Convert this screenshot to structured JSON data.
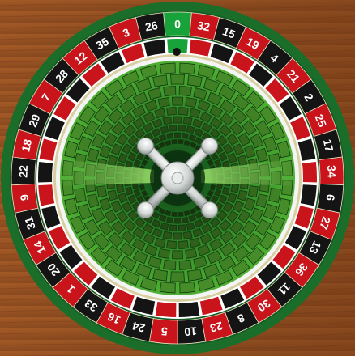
{
  "wheel": {
    "numbers": [
      {
        "n": "0",
        "c": "green"
      },
      {
        "n": "32",
        "c": "red"
      },
      {
        "n": "15",
        "c": "black"
      },
      {
        "n": "19",
        "c": "red"
      },
      {
        "n": "4",
        "c": "black"
      },
      {
        "n": "21",
        "c": "red"
      },
      {
        "n": "2",
        "c": "black"
      },
      {
        "n": "25",
        "c": "red"
      },
      {
        "n": "17",
        "c": "black"
      },
      {
        "n": "34",
        "c": "red"
      },
      {
        "n": "6",
        "c": "black"
      },
      {
        "n": "27",
        "c": "red"
      },
      {
        "n": "13",
        "c": "black"
      },
      {
        "n": "36",
        "c": "red"
      },
      {
        "n": "11",
        "c": "black"
      },
      {
        "n": "30",
        "c": "red"
      },
      {
        "n": "8",
        "c": "black"
      },
      {
        "n": "23",
        "c": "red"
      },
      {
        "n": "10",
        "c": "black"
      },
      {
        "n": "5",
        "c": "red"
      },
      {
        "n": "24",
        "c": "black"
      },
      {
        "n": "16",
        "c": "red"
      },
      {
        "n": "33",
        "c": "black"
      },
      {
        "n": "1",
        "c": "red"
      },
      {
        "n": "20",
        "c": "black"
      },
      {
        "n": "14",
        "c": "red"
      },
      {
        "n": "31",
        "c": "black"
      },
      {
        "n": "9",
        "c": "red"
      },
      {
        "n": "22",
        "c": "black"
      },
      {
        "n": "18",
        "c": "red"
      },
      {
        "n": "29",
        "c": "black"
      },
      {
        "n": "7",
        "c": "red"
      },
      {
        "n": "28",
        "c": "black"
      },
      {
        "n": "12",
        "c": "red"
      },
      {
        "n": "35",
        "c": "black"
      },
      {
        "n": "3",
        "c": "red"
      },
      {
        "n": "26",
        "c": "black"
      }
    ]
  },
  "colors": {
    "red": "#c8141a",
    "black": "#141414",
    "green": "#17a33a",
    "rim": "#1b6e2a",
    "wood": "#8a4a1f"
  },
  "icons": {
    "turret": "cross-handle-icon",
    "ball": "ball-icon"
  }
}
